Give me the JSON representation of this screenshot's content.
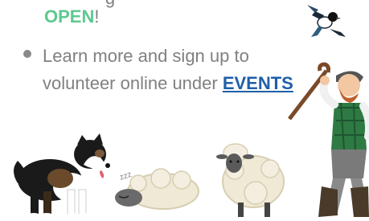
{
  "content": {
    "prev_line_fragment": "~ ~ ~ ~ g ~ ~",
    "open_word": "OPEN",
    "open_suffix": "!",
    "bullet_text": "Learn more and sign up to volunteer online under ",
    "events_link": "EVENTS"
  },
  "illustrations": {
    "bird": "magpie-icon",
    "dog": "sheepdog-icon",
    "sheep_sleeping": "sleeping-sheep-icon",
    "sleep_mark": "zzz",
    "sheep_standing": "sheep-icon",
    "shepherd": "shepherd-icon"
  },
  "colors": {
    "open": "#5cc98f",
    "link": "#1f5fa8",
    "body_text": "#808080"
  }
}
